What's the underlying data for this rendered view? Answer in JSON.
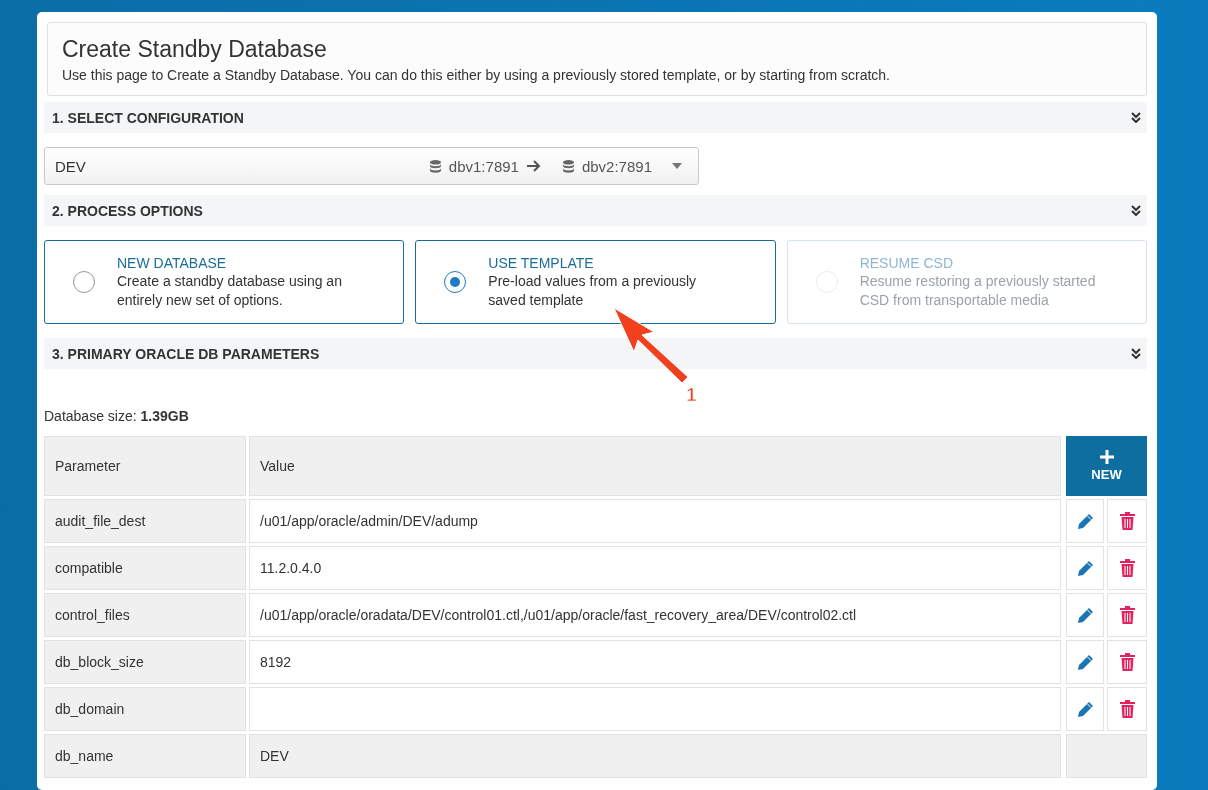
{
  "header": {
    "title": "Create Standby Database",
    "description": "Use this page to Create a Standby Database. You can do this either by using a previously stored template, or by starting from scratch."
  },
  "sections": [
    {
      "title": "1. SELECT CONFIGURATION"
    },
    {
      "title": "2. PROCESS OPTIONS"
    },
    {
      "title": "3. PRIMARY ORACLE DB PARAMETERS"
    }
  ],
  "configuration": {
    "name": "DEV",
    "source": "dbv1:7891",
    "target": "dbv2:7891"
  },
  "process_options": [
    {
      "title": "NEW DATABASE",
      "description": "Create a standby database using an entirely new set of options.",
      "selected": false,
      "disabled": false
    },
    {
      "title": "USE TEMPLATE",
      "description": "Pre-load values from a previously saved template",
      "selected": true,
      "disabled": false
    },
    {
      "title": "RESUME CSD",
      "description": "Resume restoring a previously started CSD from transportable media",
      "selected": false,
      "disabled": true
    }
  ],
  "database_size": {
    "label": "Database size:",
    "value": "1.39GB"
  },
  "parameters_table": {
    "columns": [
      "Parameter",
      "Value"
    ],
    "new_button": "NEW",
    "rows": [
      {
        "parameter": "audit_file_dest",
        "value": "/u01/app/oracle/admin/DEV/adump",
        "editable": true
      },
      {
        "parameter": "compatible",
        "value": "11.2.0.4.0",
        "editable": true
      },
      {
        "parameter": "control_files",
        "value": "/u01/app/oracle/oradata/DEV/control01.ctl,/u01/app/oracle/fast_recovery_area/DEV/control02.ctl",
        "editable": true
      },
      {
        "parameter": "db_block_size",
        "value": "8192",
        "editable": true
      },
      {
        "parameter": "db_domain",
        "value": "",
        "editable": true
      },
      {
        "parameter": "db_name",
        "value": "DEV",
        "editable": false
      }
    ]
  },
  "annotation": {
    "label": "1"
  }
}
